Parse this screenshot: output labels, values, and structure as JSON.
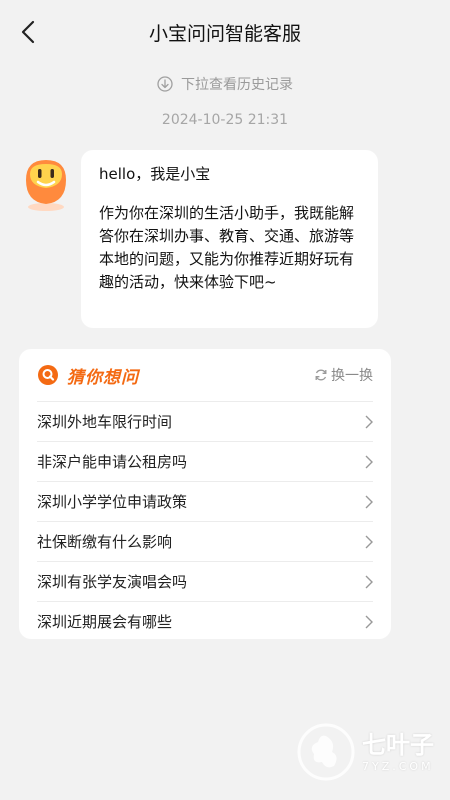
{
  "header": {
    "title": "小宝问问智能客服",
    "back_icon": "chevron-left-icon"
  },
  "history_hint": {
    "icon": "arrow-down-circle-icon",
    "text": "下拉查看历史记录"
  },
  "timestamp": "2024-10-25 21:31",
  "bot": {
    "avatar_icon": "bot-face-avatar",
    "greeting": "hello，我是小宝",
    "intro": "作为你在深圳的生活小助手，我既能解答你在深圳办事、教育、交通、旅游等本地的问题，又能为你推荐近期好玩有趣的活动，快来体验下吧~"
  },
  "suggest": {
    "title": "猜你想问",
    "refresh_label": "换一换",
    "accent_color": "#f46a13",
    "items": [
      {
        "label": "深圳外地车限行时间"
      },
      {
        "label": "非深户能申请公租房吗"
      },
      {
        "label": "深圳小学学位申请政策"
      },
      {
        "label": "社保断缴有什么影响"
      },
      {
        "label": "深圳有张学友演唱会吗"
      },
      {
        "label": "深圳近期展会有哪些"
      }
    ]
  },
  "watermark": {
    "cn": "七叶子",
    "en": "7YZ.COM"
  }
}
